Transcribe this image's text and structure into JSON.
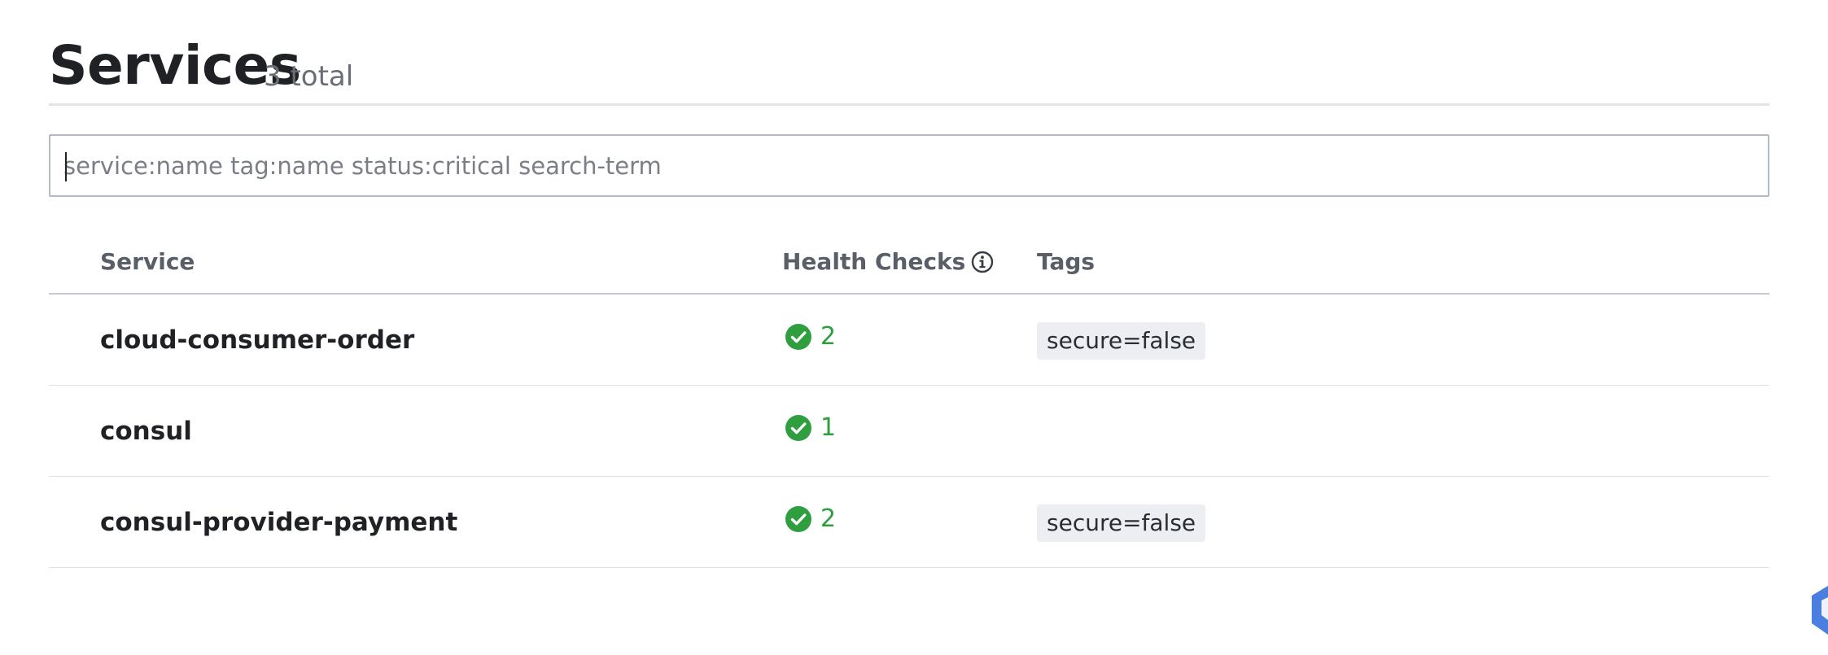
{
  "header": {
    "title": "Services",
    "total": "3 total"
  },
  "search": {
    "placeholder": "service:name tag:name status:critical search-term",
    "value": ""
  },
  "table": {
    "columns": {
      "service": "Service",
      "health": "Health Checks",
      "tags": "Tags"
    },
    "rows": [
      {
        "name": "cloud-consumer-order",
        "checks": "2",
        "tag": "secure=false"
      },
      {
        "name": "consul",
        "checks": "1",
        "tag": ""
      },
      {
        "name": "consul-provider-payment",
        "checks": "2",
        "tag": "secure=false"
      }
    ]
  },
  "colors": {
    "passing": "#2e9e3f",
    "accent": "#3b6fd8"
  },
  "icons": {
    "info": "info-circle-icon",
    "passing": "check-circle-icon",
    "corner": "shield-badge-icon"
  }
}
